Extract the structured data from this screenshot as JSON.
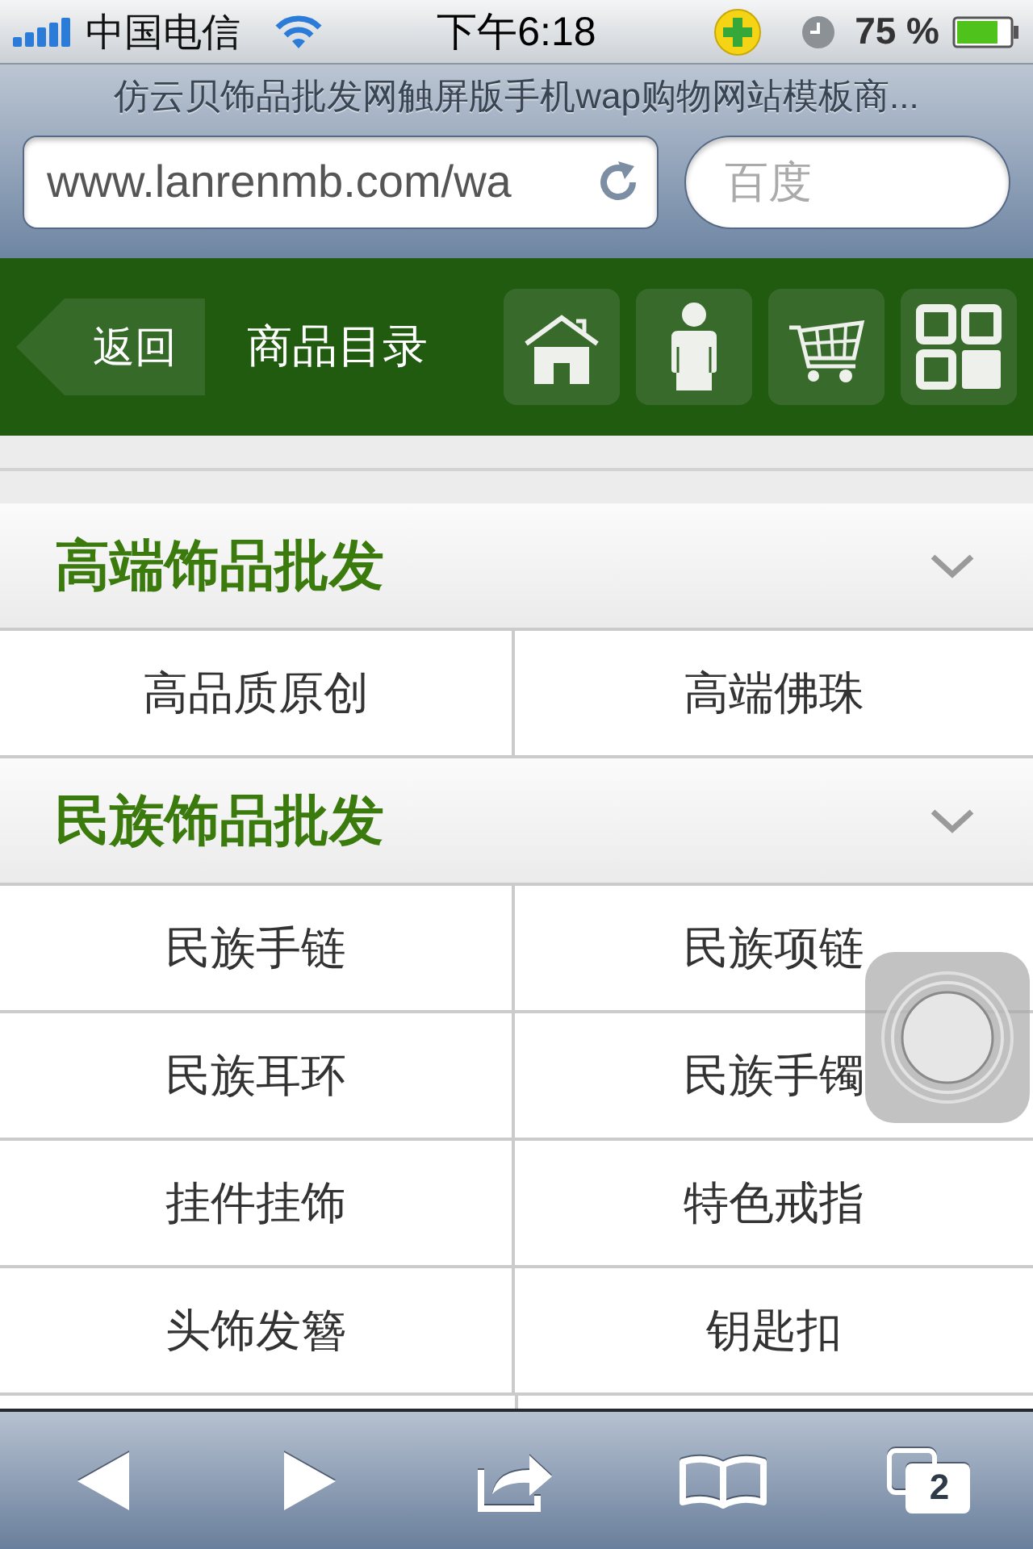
{
  "status_bar": {
    "carrier": "中国电信",
    "time": "下午6:18",
    "battery": "75 %"
  },
  "browser": {
    "page_title": "仿云贝饰品批发网触屏版手机wap购物网站模板商...",
    "address": "www.lanrenmb.com/wa",
    "search": {
      "placeholder": "百度"
    }
  },
  "header": {
    "back": "返回",
    "title": "商品目录"
  },
  "categories": [
    {
      "title": "高端饰品批发",
      "items": [
        "高品质原创",
        "高端佛珠"
      ]
    },
    {
      "title": "民族饰品批发",
      "items": [
        "民族手链",
        "民族项链",
        "民族耳环",
        "民族手镯",
        "挂件挂饰",
        "特色戒指",
        "头饰发簪",
        "钥匙扣"
      ]
    }
  ],
  "toolbar": {
    "open_tabs": "2"
  }
}
